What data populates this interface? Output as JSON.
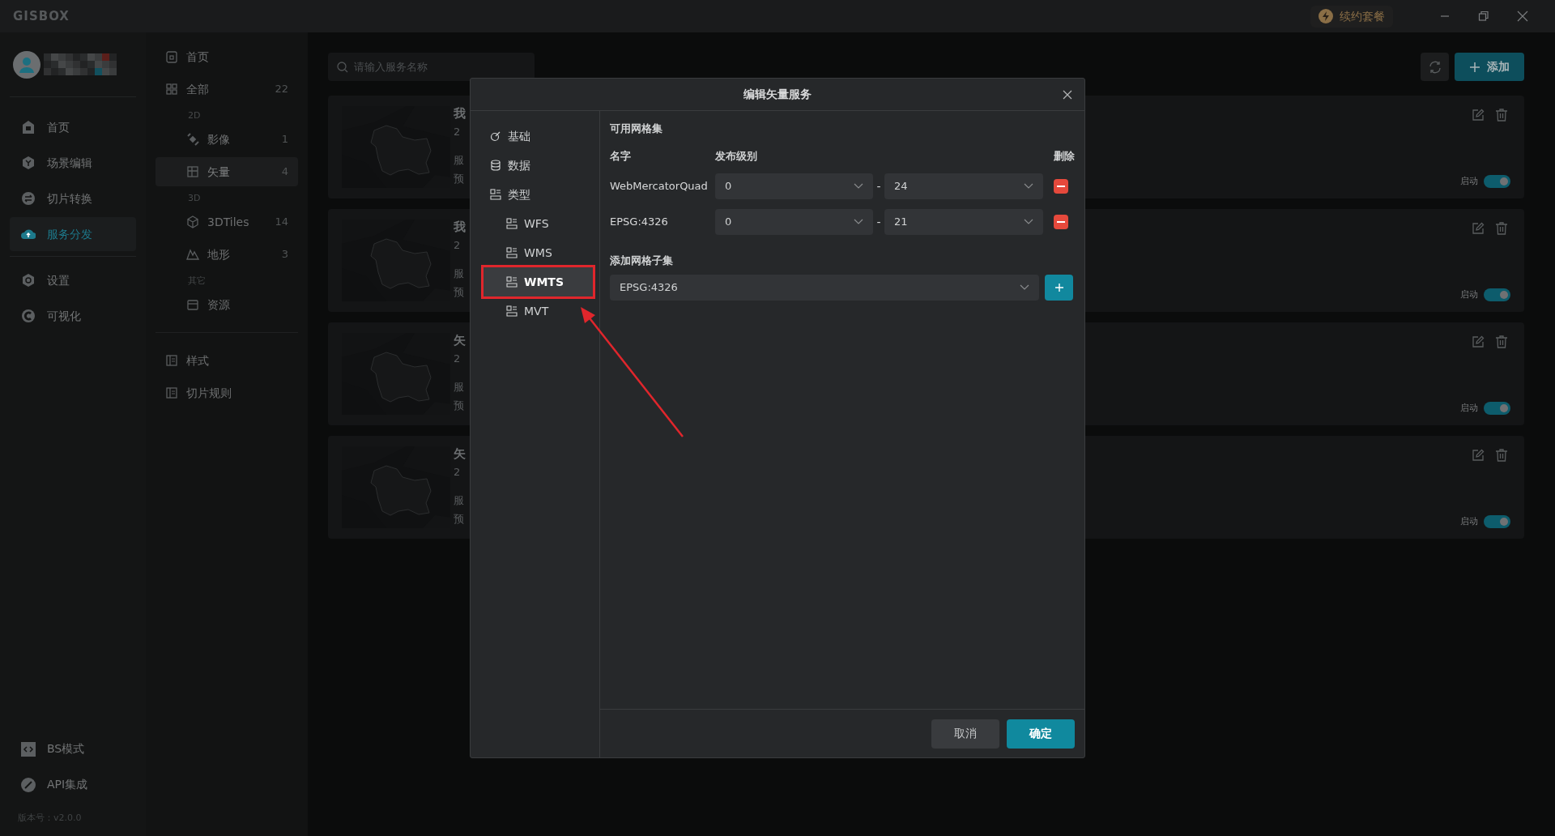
{
  "title_bar": {
    "logo": "GISBOX",
    "renew_button": "续约套餐"
  },
  "nav": {
    "items": [
      {
        "label": "首页",
        "selected": false
      },
      {
        "label": "场景编辑",
        "selected": false
      },
      {
        "label": "切片转换",
        "selected": false
      },
      {
        "label": "服务分发",
        "selected": true
      },
      {
        "label": "设置",
        "selected": false
      },
      {
        "label": "可视化",
        "selected": false
      }
    ],
    "bottom_items": [
      {
        "label": "BS模式"
      },
      {
        "label": "API集成"
      }
    ],
    "version": "版本号：v2.0.0"
  },
  "category_menu": {
    "items": [
      {
        "label": "首页",
        "selected": false
      },
      {
        "label": "全部",
        "count": "22",
        "selected": false,
        "children": [
          {
            "kind": "heading",
            "label": "2D"
          },
          {
            "kind": "item",
            "label": "影像",
            "count": "1",
            "selected": false
          },
          {
            "kind": "item",
            "label": "矢量",
            "count": "4",
            "selected": true
          },
          {
            "kind": "heading",
            "label": "3D"
          },
          {
            "kind": "item",
            "label": "3DTiles",
            "count": "14",
            "selected": false
          },
          {
            "kind": "item",
            "label": "地形",
            "count": "3",
            "selected": false
          },
          {
            "kind": "heading",
            "label": "其它"
          },
          {
            "kind": "item",
            "label": "资源",
            "selected": false
          }
        ]
      }
    ],
    "bottom_items": [
      {
        "label": "样式",
        "selected": false
      },
      {
        "label": "切片规则",
        "selected": false
      }
    ]
  },
  "search": {
    "placeholder": "请输入服务名称"
  },
  "add_button": "添加",
  "cards": [
    {
      "title": "我",
      "date": "2",
      "line_1": "服",
      "line_2": "预",
      "toggle_label": "启动",
      "enabled": true
    },
    {
      "title": "我",
      "date": "2",
      "line_1": "服",
      "line_2": "预",
      "toggle_label": "启动",
      "enabled": true
    },
    {
      "title": "矢",
      "date": "2",
      "line_1": "服",
      "line_2": "预",
      "toggle_label": "启动",
      "enabled": true
    },
    {
      "title": "矢",
      "date": "2",
      "line_1": "服",
      "line_2": "预",
      "toggle_label": "启动",
      "enabled": true
    }
  ],
  "dialog": {
    "title": "编辑矢量服务",
    "nav": [
      {
        "label": "基础",
        "selected": false
      },
      {
        "label": "数据",
        "selected": false
      },
      {
        "label": "类型",
        "selected": false,
        "children": [
          {
            "label": "WFS",
            "selected": false,
            "annotated": false
          },
          {
            "label": "WMS",
            "selected": false,
            "annotated": false
          },
          {
            "label": "WMTS",
            "selected": true,
            "annotated": true
          },
          {
            "label": "MVT",
            "selected": false,
            "annotated": false
          }
        ]
      }
    ],
    "grid_sets": {
      "heading": "可用网格集",
      "columns": [
        "名字",
        "发布级别",
        "删除"
      ],
      "rows": [
        {
          "name": "WebMercatorQuad",
          "min_level": "0",
          "separator": "-",
          "max_level": "24"
        },
        {
          "name": "EPSG:4326",
          "min_level": "0",
          "separator": "-",
          "max_level": "21"
        }
      ]
    },
    "add_subset": {
      "heading": "添加网格子集",
      "value": "EPSG:4326"
    },
    "buttons": [
      {
        "label": "取消",
        "primary": false
      },
      {
        "label": "确定",
        "primary": true
      }
    ]
  }
}
